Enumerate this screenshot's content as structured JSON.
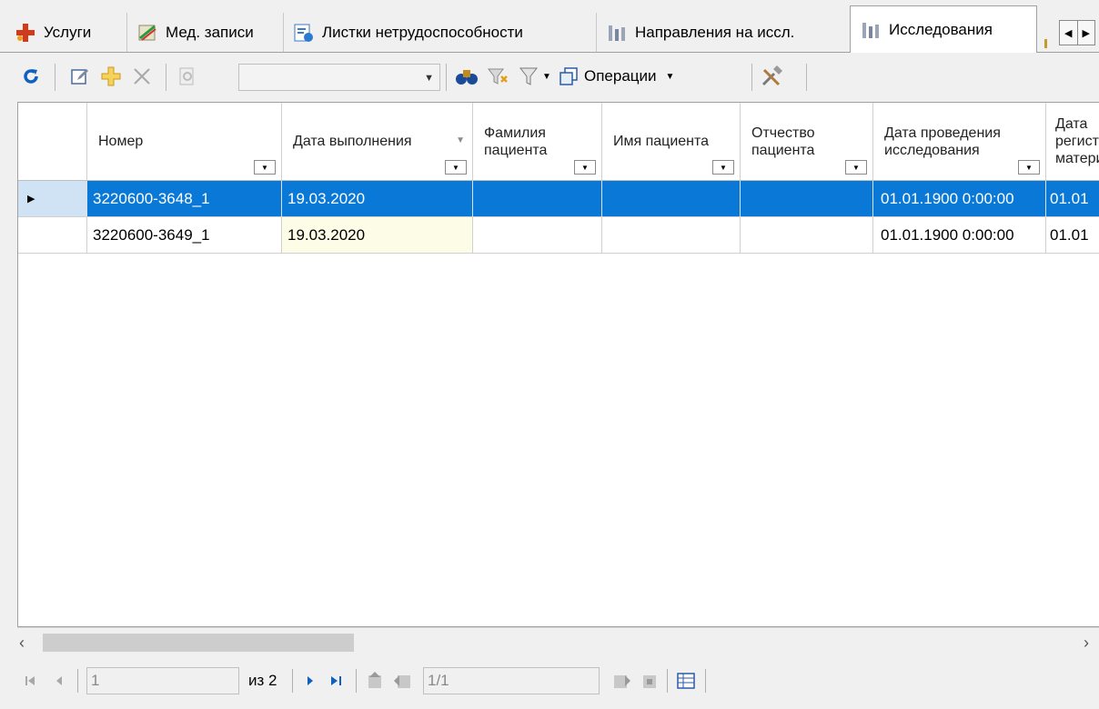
{
  "tabs": [
    {
      "label": "Услуги",
      "icon": "services-icon"
    },
    {
      "label": "Мед. записи",
      "icon": "medical-records-icon"
    },
    {
      "label": "Листки нетрудоспособности",
      "icon": "sick-leave-icon"
    },
    {
      "label": "Направления на иссл.",
      "icon": "referrals-icon"
    },
    {
      "label": "Исследования",
      "icon": "research-icon",
      "active": true
    }
  ],
  "toolbar": {
    "combo_value": "",
    "operations_label": "Операции"
  },
  "grid": {
    "columns": [
      "Номер",
      "Дата выполнения",
      "Фамилия пациента",
      "Имя пациента",
      "Отчество пациента",
      "Дата проведения исследования",
      "Дата регистрации материала"
    ],
    "rows": [
      {
        "number": "3220600-3648_1",
        "date": "19.03.2020",
        "last_name": "",
        "first_name": "",
        "patronymic": "",
        "research_date": "01.01.1900 0:00:00",
        "reg_date": "01.01",
        "selected": true
      },
      {
        "number": "3220600-3649_1",
        "date": "19.03.2020",
        "last_name": "",
        "first_name": "",
        "patronymic": "",
        "research_date": "01.01.1900 0:00:00",
        "reg_date": "01.01",
        "selected": false
      }
    ]
  },
  "navigator": {
    "position": "1",
    "of_label": "из 2",
    "page": "1/1"
  },
  "colors": {
    "selection": "#0a78d7",
    "accent": "#1060c0"
  }
}
